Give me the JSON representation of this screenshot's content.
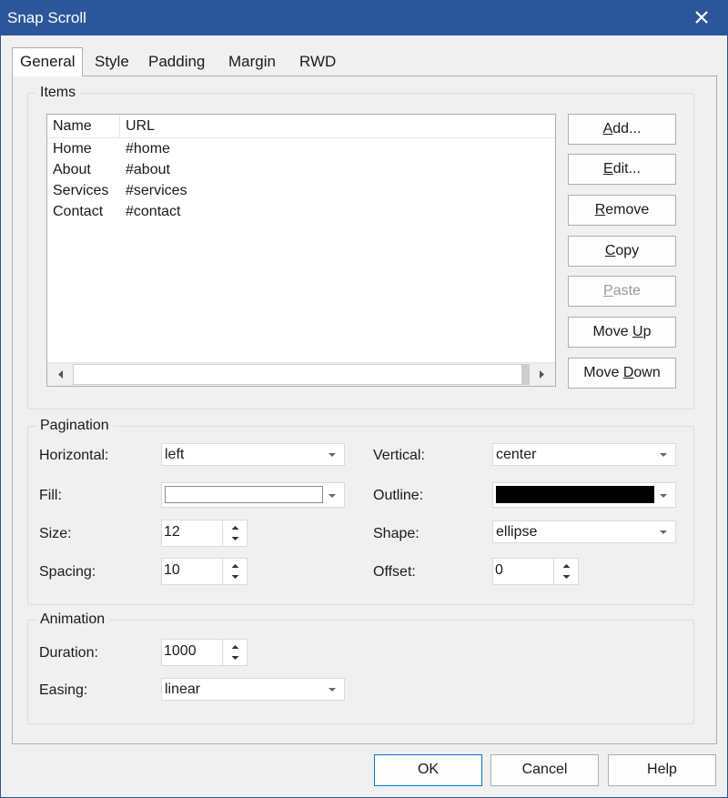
{
  "window": {
    "title": "Snap Scroll"
  },
  "tabs": [
    "General",
    "Style",
    "Padding",
    "Margin",
    "RWD"
  ],
  "items": {
    "legend": "Items",
    "columns": [
      "Name",
      "URL"
    ],
    "rows": [
      {
        "name": "Home",
        "url": "#home"
      },
      {
        "name": "About",
        "url": "#about"
      },
      {
        "name": "Services",
        "url": "#services"
      },
      {
        "name": "Contact",
        "url": "#contact"
      }
    ],
    "buttons": {
      "add": {
        "pre": "",
        "key": "A",
        "post": "dd..."
      },
      "edit": {
        "pre": "",
        "key": "E",
        "post": "dit..."
      },
      "remove": {
        "pre": "",
        "key": "R",
        "post": "emove"
      },
      "copy": {
        "pre": "",
        "key": "C",
        "post": "opy"
      },
      "paste": {
        "pre": "",
        "key": "P",
        "post": "aste"
      },
      "move_up": {
        "pre": "Move ",
        "key": "U",
        "post": "p"
      },
      "move_down": {
        "pre": "Move ",
        "key": "D",
        "post": "own"
      }
    }
  },
  "pagination": {
    "legend": "Pagination",
    "horizontal": {
      "label": "Horizontal:",
      "value": "left"
    },
    "vertical": {
      "label": "Vertical:",
      "value": "center"
    },
    "fill": {
      "label": "Fill:",
      "color": "#ffffff"
    },
    "outline": {
      "label": "Outline:",
      "color": "#000000"
    },
    "size": {
      "label": "Size:",
      "value": "12"
    },
    "shape": {
      "label": "Shape:",
      "value": "ellipse"
    },
    "spacing": {
      "label": "Spacing:",
      "value": "10"
    },
    "offset": {
      "label": "Offset:",
      "value": "0"
    }
  },
  "animation": {
    "legend": "Animation",
    "duration": {
      "label": "Duration:",
      "value": "1000"
    },
    "easing": {
      "label": "Easing:",
      "value": "linear"
    }
  },
  "footer": {
    "ok": "OK",
    "cancel": "Cancel",
    "help": "Help"
  },
  "icons": {
    "close": "close-icon",
    "dropdown": "chevron-down-icon",
    "spin_up": "chevron-up-icon",
    "spin_down": "chevron-down-icon",
    "scroll_left": "scroll-left-icon",
    "scroll_right": "scroll-right-icon"
  },
  "colors": {
    "titlebar": "#2b579a",
    "default_button_border": "#0078d7"
  }
}
